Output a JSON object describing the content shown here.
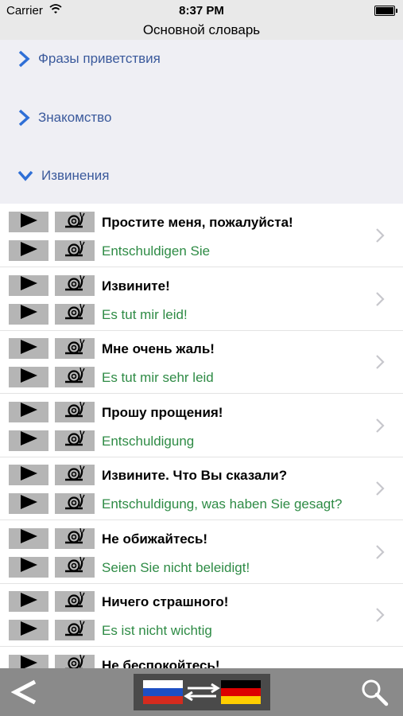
{
  "status": {
    "carrier": "Carrier",
    "time": "8:37 PM"
  },
  "nav": {
    "title": "Основной словарь"
  },
  "categories": [
    {
      "label": "Фразы приветствия",
      "state": "collapsed"
    },
    {
      "label": "Знакомство",
      "state": "collapsed"
    },
    {
      "label": "Извинения",
      "state": "expanded"
    }
  ],
  "phrases": [
    {
      "ru": "Простите меня, пожалуйста!",
      "de": "Entschuldigen Sie"
    },
    {
      "ru": "Извините!",
      "de": "Es tut mir leid!"
    },
    {
      "ru": "Мне очень жаль!",
      "de": "Es tut mir sehr leid"
    },
    {
      "ru": "Прошу прощения!",
      "de": "Entschuldigung"
    },
    {
      "ru": "Извините. Что Вы сказали?",
      "de": "Entschuldigung, was haben Sie gesagt?"
    },
    {
      "ru": "Не обижайтесь!",
      "de": "Seien Sie nicht beleidigt!"
    },
    {
      "ru": "Ничего страшного!",
      "de": "Es ist nicht wichtig"
    },
    {
      "ru": "Не беспокойтесь!",
      "de": ""
    }
  ],
  "icons": {
    "play": "play-icon",
    "slow": "snail-icon",
    "row_chevron": "chevron-right-icon",
    "back": "back-arrow-icon",
    "swap": "swap-arrows-icon",
    "search": "search-icon"
  },
  "colors": {
    "bar": "#e9e9e9",
    "category_text": "#3b5a9c",
    "german_text": "#2e8b45",
    "bottom_bar": "#8a8a8a",
    "button": "#b5b5b5"
  }
}
